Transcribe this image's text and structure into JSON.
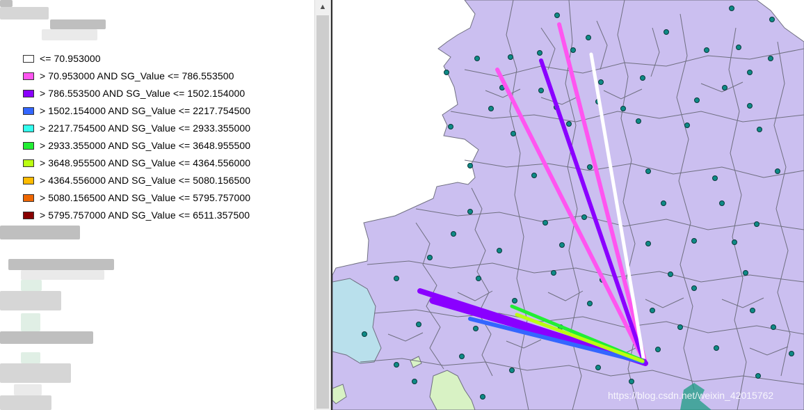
{
  "legend": {
    "items": [
      {
        "label": "<= 70.953000",
        "color": "#ffffff"
      },
      {
        "label": "> 70.953000 AND SG_Value <= 786.553500",
        "color": "#ff55f0"
      },
      {
        "label": "> 786.553500 AND SG_Value <= 1502.154000",
        "color": "#8a00ff"
      },
      {
        "label": "> 1502.154000 AND SG_Value <= 2217.754500",
        "color": "#3366ff"
      },
      {
        "label": "> 2217.754500 AND SG_Value <= 2933.355000",
        "color": "#33ffee"
      },
      {
        "label": "> 2933.355000 AND SG_Value <= 3648.955500",
        "color": "#22ee33"
      },
      {
        "label": "> 3648.955500 AND SG_Value <= 4364.556000",
        "color": "#bbff11"
      },
      {
        "label": "> 4364.556000 AND SG_Value <= 5080.156500",
        "color": "#ffbb00"
      },
      {
        "label": "> 5080.156500 AND SG_Value <= 5795.757000",
        "color": "#ee6600"
      },
      {
        "label": "> 5795.757000 AND SG_Value <= 6511.357500",
        "color": "#880000"
      }
    ]
  },
  "scrollbar": {
    "up_arrow": "▲"
  },
  "map": {
    "region_fill": "#cbbff0",
    "boundary_color": "#6f6f80",
    "lake_fill": "#b9e0ec",
    "green_fill": "#d8f2c4",
    "point_color": "#0e8a86",
    "flow_lines": [
      {
        "color_ref": "magenta"
      },
      {
        "color_ref": "magenta"
      },
      {
        "color_ref": "purple"
      },
      {
        "color_ref": "white"
      },
      {
        "color_ref": "purple"
      },
      {
        "color_ref": "purple"
      },
      {
        "color_ref": "blue"
      },
      {
        "color_ref": "green"
      },
      {
        "color_ref": "lime"
      }
    ]
  },
  "watermark": "https://blog.csdn.net/weixin_42015762"
}
